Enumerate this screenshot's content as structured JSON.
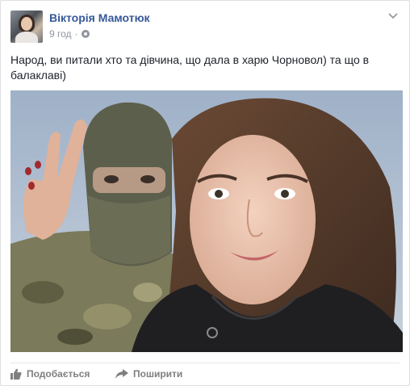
{
  "post": {
    "author": "Вікторія Мамотюк",
    "time": "9 год",
    "separator": "·",
    "text": "Народ, ви питали хто та дівчина, що дала в харю Чорновол) та що в балаклаві)",
    "privacy_icon": "globe-icon",
    "menu_icon": "chevron-down-icon"
  },
  "photo": {
    "subject": "selfie-photo"
  },
  "actions": {
    "like_label": "Подобається",
    "share_label": "Поширити",
    "like_icon": "thumbs-up-icon",
    "share_icon": "share-arrow-icon"
  },
  "colors": {
    "author_link": "#365899",
    "meta_gray": "#90949c",
    "action_gray": "#7f7f7f"
  }
}
